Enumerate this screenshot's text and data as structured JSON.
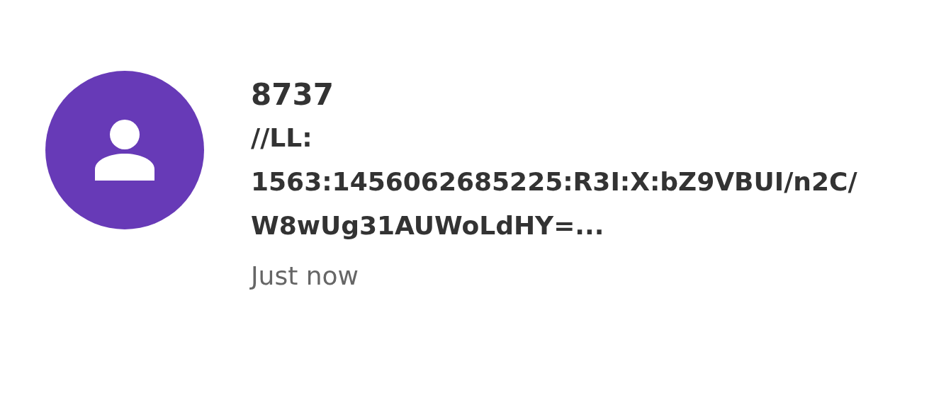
{
  "notification": {
    "sender": "8737",
    "message": "//LL: 1563:1456062685225:R3I:X:bZ9VBUI/n2C/W8wUg31AUWoLdHY=...",
    "time": "Just now"
  }
}
